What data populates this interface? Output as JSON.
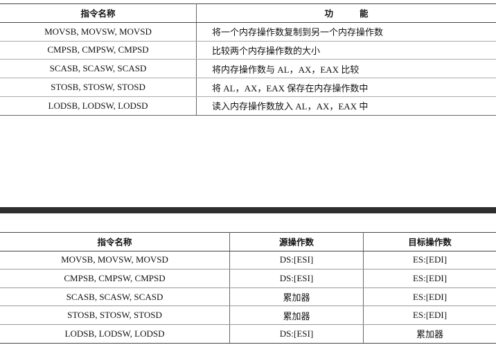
{
  "table1": {
    "headers": [
      "指令名称",
      "功",
      "能"
    ],
    "rows": [
      [
        "MOVSB, MOVSW, MOVSD",
        "将一个内存操作数复制到另一个内存操作数"
      ],
      [
        "CMPSB, CMPSW, CMPSD",
        "比较两个内存操作数的大小"
      ],
      [
        "SCASB, SCASW, SCASD",
        "将内存操作数与 AL，AX，EAX 比较"
      ],
      [
        "STOSB, STOSW, STOSD",
        "将 AL，AX，EAX 保存在内存操作数中"
      ],
      [
        "LODSB, LODSW, LODSD",
        "读入内存操作数放入 AL，AX，EAX 中"
      ]
    ]
  },
  "table2": {
    "headers": [
      "指令名称",
      "源操作数",
      "目标操作数"
    ],
    "rows": [
      [
        "MOVSB, MOVSW, MOVSD",
        "DS:[ESI]",
        "ES:[EDI]"
      ],
      [
        "CMPSB, CMPSW, CMPSD",
        "DS:[ESI]",
        "ES:[EDI]"
      ],
      [
        "SCASB, SCASW, SCASD",
        "累加器",
        "ES:[EDI]"
      ],
      [
        "STOSB, STOSW, STOSD",
        "累加器",
        "ES:[EDI]"
      ],
      [
        "LODSB, LODSW, LODSD",
        "DS:[ESI]",
        "累加器"
      ]
    ]
  }
}
